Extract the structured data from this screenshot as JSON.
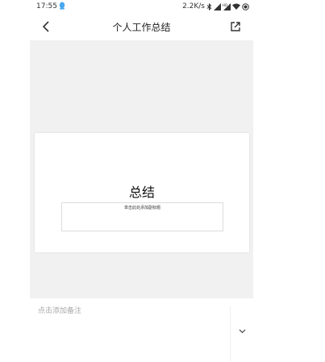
{
  "status_bar": {
    "time": "17:55",
    "net_speed": "2.2K/s",
    "icons": [
      "qq-bubble-icon",
      "bluetooth-icon",
      "signal-icon",
      "hd-signal-icon",
      "wifi-icon",
      "battery-icon"
    ]
  },
  "header": {
    "title": "个人工作总结",
    "back_icon": "back-arrow-icon",
    "share_icon": "external-share-icon"
  },
  "slide": {
    "title": "总结",
    "subtitle_placeholder": "单击此处添加副标题"
  },
  "notes": {
    "placeholder": "点击添加备注",
    "expand_icon": "chevron-down-icon"
  },
  "colors": {
    "preview_background": "#f1f1f1",
    "placeholder_text": "#a8a8a8",
    "bubble_blue": "#4aa8f0"
  }
}
